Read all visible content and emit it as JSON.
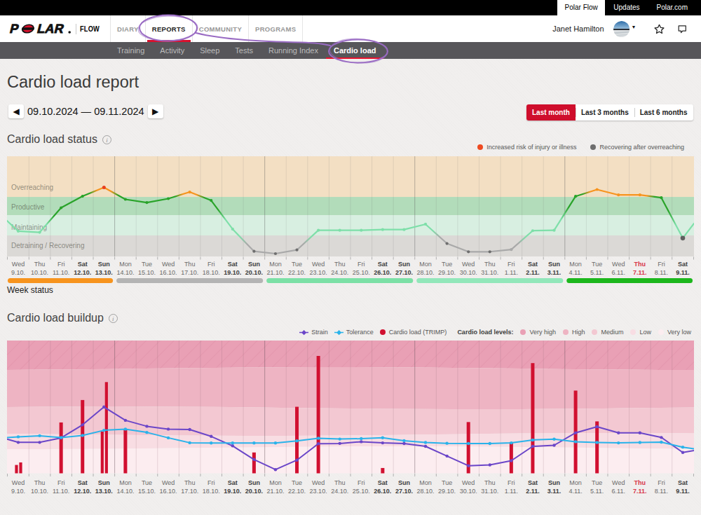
{
  "topbar": {
    "items": [
      {
        "label": "Polar Flow",
        "active": true
      },
      {
        "label": "Updates"
      },
      {
        "label": "Polar.com"
      }
    ]
  },
  "navbar": {
    "logo": "POLAR",
    "brand": "FLOW",
    "items": [
      {
        "label": "DIARY"
      },
      {
        "label": "REPORTS",
        "active": true
      },
      {
        "label": "COMMUNITY"
      },
      {
        "label": "PROGRAMS"
      }
    ],
    "user": "Janet Hamilton",
    "icons": [
      "chevron-down-icon",
      "favorites-star-icon",
      "chat-bubble-icon"
    ],
    "logo_icon": "polar-logo"
  },
  "subnav": {
    "items": [
      {
        "label": "Training"
      },
      {
        "label": "Activity"
      },
      {
        "label": "Sleep"
      },
      {
        "label": "Tests"
      },
      {
        "label": "Running Index"
      },
      {
        "label": "Cardio load",
        "active": true
      }
    ]
  },
  "page": {
    "title": "Cardio load report",
    "date_range": "09.10.2024 — 09.11.2024",
    "range_buttons": [
      {
        "label": "Last month",
        "active": true
      },
      {
        "label": "Last 3 months"
      },
      {
        "label": "Last 6 months"
      }
    ],
    "prev_icon": "left-arrow-icon",
    "next_icon": "right-arrow-icon"
  },
  "status_section": {
    "heading": "Cardio load status",
    "legend": [
      {
        "label": "Increased risk of injury or illness",
        "color": "#ee4a21"
      },
      {
        "label": "Recovering after overreaching",
        "color": "#6e6e6e"
      }
    ],
    "week_status_label": "Week status",
    "info_icon": "info-icon"
  },
  "buildup_section": {
    "heading": "Cardio load buildup",
    "legend": [
      {
        "label": "Strain",
        "color": "#6b46c8",
        "marker": "diamond-line"
      },
      {
        "label": "Tolerance",
        "color": "#2ab3ea",
        "marker": "diamond-line"
      },
      {
        "label": "Cardio load (TRIMP)",
        "color": "#d11030",
        "marker": "dot"
      }
    ],
    "levels_label": "Cardio load levels:",
    "levels": [
      {
        "label": "Very high",
        "color": "#e9a0b5"
      },
      {
        "label": "High",
        "color": "#eeb4c3"
      },
      {
        "label": "Medium",
        "color": "#f3c8d2"
      },
      {
        "label": "Low",
        "color": "#f8dde3"
      },
      {
        "label": "Very low",
        "color": "#fcedf0"
      }
    ],
    "info_icon": "info-icon"
  },
  "days": [
    {
      "dow": "Wed",
      "date": "9.10."
    },
    {
      "dow": "Thu",
      "date": "10.10."
    },
    {
      "dow": "Fri",
      "date": "11.10."
    },
    {
      "dow": "Sat",
      "date": "12.10.",
      "weekend": true
    },
    {
      "dow": "Sun",
      "date": "13.10.",
      "weekend": true
    },
    {
      "dow": "Mon",
      "date": "14.10."
    },
    {
      "dow": "Tue",
      "date": "15.10."
    },
    {
      "dow": "Wed",
      "date": "16.10."
    },
    {
      "dow": "Thu",
      "date": "17.10."
    },
    {
      "dow": "Fri",
      "date": "18.10."
    },
    {
      "dow": "Sat",
      "date": "19.10.",
      "weekend": true
    },
    {
      "dow": "Sun",
      "date": "20.10.",
      "weekend": true
    },
    {
      "dow": "Mon",
      "date": "21.10."
    },
    {
      "dow": "Tue",
      "date": "22.10."
    },
    {
      "dow": "Wed",
      "date": "23.10."
    },
    {
      "dow": "Thu",
      "date": "24.10."
    },
    {
      "dow": "Fri",
      "date": "25.10."
    },
    {
      "dow": "Sat",
      "date": "26.10.",
      "weekend": true
    },
    {
      "dow": "Sun",
      "date": "27.10.",
      "weekend": true
    },
    {
      "dow": "Mon",
      "date": "28.10."
    },
    {
      "dow": "Tue",
      "date": "29.10."
    },
    {
      "dow": "Wed",
      "date": "30.10."
    },
    {
      "dow": "Thu",
      "date": "31.10."
    },
    {
      "dow": "Fri",
      "date": "1.11."
    },
    {
      "dow": "Sat",
      "date": "2.11.",
      "weekend": true
    },
    {
      "dow": "Sun",
      "date": "3.11.",
      "weekend": true
    },
    {
      "dow": "Mon",
      "date": "4.11."
    },
    {
      "dow": "Tue",
      "date": "5.11."
    },
    {
      "dow": "Wed",
      "date": "6.11."
    },
    {
      "dow": "Thu",
      "date": "7.11.",
      "today": true
    },
    {
      "dow": "Fri",
      "date": "8.11."
    },
    {
      "dow": "Sat",
      "date": "9.11.",
      "weekend": true
    }
  ],
  "chart_data": [
    {
      "type": "line",
      "title": "Cardio load status",
      "bands": [
        {
          "label": "Overreaching",
          "color": "#f3dfc3",
          "to_pct": 40.6
        },
        {
          "label": "Productive",
          "color": "#b2dcba",
          "to_pct": 58.8
        },
        {
          "label": "Maintaining",
          "color": "#d8efe1",
          "to_pct": 79.0
        },
        {
          "label": "Detraining / Recovering",
          "color": "#dbd9d6",
          "to_pct": 100
        }
      ],
      "status_colors": {
        "maintaining": "#7edfa9",
        "productive": "#29a329",
        "overreaching": "#f7941e",
        "risk": "#e83f20",
        "recovering": "#a9a9a9",
        "recovering_end": "#5e5e5e"
      },
      "point_colors": {
        "recovering": "#6e6e6e"
      },
      "point_color_overrides": {
        "23": "#a9a9a9"
      },
      "lead_pos": 64.3,
      "tail_pos": 67.0,
      "points": [
        {
          "status": "maintaining",
          "pos": 74.8
        },
        {
          "status": "maintaining",
          "pos": 75.9
        },
        {
          "status": "productive",
          "pos": 51.4
        },
        {
          "status": "productive",
          "pos": 39.9
        },
        {
          "status": "risk",
          "pos": 31.1
        },
        {
          "status": "productive",
          "pos": 43.0
        },
        {
          "status": "productive",
          "pos": 46.2
        },
        {
          "status": "productive",
          "pos": 42.3
        },
        {
          "status": "overreaching",
          "pos": 35.7
        },
        {
          "status": "productive",
          "pos": 44.1
        },
        {
          "status": "maintaining",
          "pos": 72.7
        },
        {
          "status": "recovering",
          "pos": 94.9
        },
        {
          "status": "recovering",
          "pos": 97.2
        },
        {
          "status": "recovering",
          "pos": 93.5
        },
        {
          "status": "maintaining",
          "pos": 73.9
        },
        {
          "status": "maintaining",
          "pos": 73.9
        },
        {
          "status": "maintaining",
          "pos": 73.9
        },
        {
          "status": "maintaining",
          "pos": 73.2
        },
        {
          "status": "maintaining",
          "pos": 73.2
        },
        {
          "status": "maintaining",
          "pos": 67.8
        },
        {
          "status": "recovering",
          "pos": 87.1
        },
        {
          "status": "recovering",
          "pos": 95.3
        },
        {
          "status": "recovering",
          "pos": 95.3
        },
        {
          "status": "recovering",
          "pos": 93.1
        },
        {
          "status": "maintaining",
          "pos": 74.3
        },
        {
          "status": "maintaining",
          "pos": 73.9
        },
        {
          "status": "productive",
          "pos": 40.0
        },
        {
          "status": "overreaching",
          "pos": 33.2
        },
        {
          "status": "overreaching",
          "pos": 38.6
        },
        {
          "status": "overreaching",
          "pos": 38.6
        },
        {
          "status": "productive",
          "pos": 41.4
        },
        {
          "status": "recovering_end",
          "pos": 81.7
        }
      ],
      "week_status": [
        {
          "from_day": 0,
          "to_day": 4,
          "color": "#f7941e"
        },
        {
          "from_day": 5,
          "to_day": 11,
          "color": "#b4b4b4"
        },
        {
          "from_day": 12,
          "to_day": 18,
          "color": "#7ce0a6"
        },
        {
          "from_day": 19,
          "to_day": 25,
          "color": "#92e7ba"
        },
        {
          "from_day": 26,
          "to_day": 31,
          "color": "#1cb71c"
        }
      ]
    },
    {
      "type": "bars+lines",
      "title": "Cardio load buildup",
      "level_bands": [
        {
          "label": "Very high",
          "color": "#e9a0b5",
          "hatch": true,
          "to_pct": 21.1
        },
        {
          "label": "High",
          "color": "#eeb4c3",
          "to_pct": 50.7
        },
        {
          "label": "Medium",
          "color": "#f3c8d2",
          "to_pct": 70.7
        },
        {
          "label": "Low",
          "color": "#f8dde3",
          "to_pct": 80.7
        },
        {
          "label": "Very low",
          "color": "#fcedf0",
          "to_pct": 100
        }
      ],
      "series": [
        {
          "name": "Strain",
          "color": "#6b46c8",
          "lead": 74.2,
          "tail": 82.9,
          "pos": [
            76.7,
            76.7,
            73.3,
            63.5,
            50.0,
            60.1,
            64.6,
            66.7,
            67.0,
            72.2,
            79.3,
            89.6,
            97.2,
            90.1,
            77.7,
            77.5,
            76.2,
            77.1,
            77.6,
            79.7,
            87.0,
            94.3,
            93.7,
            90.5,
            79.7,
            78.9,
            69.5,
            64.9,
            69.5,
            69.5,
            73.0,
            84.3
          ]
        },
        {
          "name": "Tolerance",
          "color": "#2ab3ea",
          "lead": 73.1,
          "tail": 81.5,
          "pos": [
            72.5,
            71.7,
            73.1,
            71.5,
            67.6,
            66.7,
            69.2,
            73.3,
            77.0,
            77.2,
            77.2,
            77.2,
            77.2,
            75.6,
            73.6,
            74.2,
            73.9,
            73.2,
            75.4,
            76.8,
            77.4,
            77.6,
            77.6,
            77.1,
            74.9,
            74.3,
            76.2,
            76.8,
            77.1,
            76.8,
            76.5,
            80.3
          ]
        }
      ],
      "bars": {
        "name": "Cardio load (TRIMP)",
        "color": "#d11030",
        "heights_pct_by_day": [
          [
            6.3,
            8.2
          ],
          null,
          [
            38.3
          ],
          [
            55.2
          ],
          [
            31.4,
            68.7
          ],
          [
            33.5
          ],
          null,
          null,
          null,
          null,
          null,
          [
            15.7
          ],
          null,
          [
            50.1
          ],
          [
            88.4
          ],
          null,
          null,
          [
            4.0
          ],
          null,
          null,
          null,
          [
            38.6
          ],
          null,
          [
            23.5
          ],
          [
            83.0
          ],
          null,
          [
            62.3
          ],
          [
            39.1
          ],
          null,
          null,
          null,
          null
        ]
      }
    }
  ]
}
